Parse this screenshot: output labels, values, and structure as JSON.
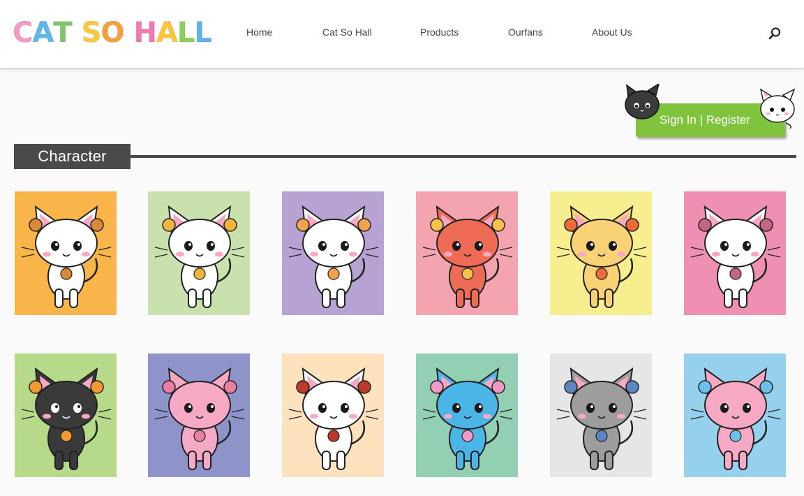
{
  "header": {
    "logo_words": [
      [
        {
          "ch": "C",
          "color": "#f29ac6"
        },
        {
          "ch": "A",
          "color": "#5bb8e8"
        },
        {
          "ch": "T",
          "color": "#7cc66c"
        }
      ],
      [
        {
          "ch": "S",
          "color": "#f7c93a"
        },
        {
          "ch": "O",
          "color": "#f6a03b"
        }
      ],
      [
        {
          "ch": "H",
          "color": "#ee7ab0"
        },
        {
          "ch": "A",
          "color": "#f8c73c"
        },
        {
          "ch": "L",
          "color": "#8ccf5a"
        },
        {
          "ch": "L",
          "color": "#5fb4e6"
        }
      ]
    ],
    "nav": [
      {
        "label": "Home"
      },
      {
        "label": "Cat So Hall"
      },
      {
        "label": "Products"
      },
      {
        "label": "Ourfans"
      },
      {
        "label": "About Us"
      }
    ]
  },
  "signin": {
    "label": "Sign In | Register",
    "color": "#7fc43c"
  },
  "section": {
    "title": "Character"
  },
  "characters": [
    {
      "sign": "aries",
      "bg": "#f9b54a",
      "fur": "#ffffff",
      "accent": "#d9893a"
    },
    {
      "sign": "taurus",
      "bg": "#c9e2ad",
      "fur": "#ffffff",
      "accent": "#f0b43c"
    },
    {
      "sign": "gemini",
      "bg": "#b6a3d3",
      "fur": "#ffffff",
      "accent": "#f2a24a"
    },
    {
      "sign": "cancer",
      "bg": "#f3a4ae",
      "fur": "#ee6b55",
      "accent": "#f4c24a"
    },
    {
      "sign": "leo",
      "bg": "#f7ef8f",
      "fur": "#f9d276",
      "accent": "#ee6a36"
    },
    {
      "sign": "virgo",
      "bg": "#ef8fb3",
      "fur": "#ffffff",
      "accent": "#c6657f"
    },
    {
      "sign": "libra",
      "bg": "#b6d98a",
      "fur": "#3a3a3a",
      "accent": "#f29a2e"
    },
    {
      "sign": "scorpio",
      "bg": "#8e94c9",
      "fur": "#f6a9c4",
      "accent": "#e97fa6"
    },
    {
      "sign": "sagittarius",
      "bg": "#fde2bd",
      "fur": "#ffffff",
      "accent": "#c03a2b"
    },
    {
      "sign": "capricorn",
      "bg": "#93cfb2",
      "fur": "#4bb6e6",
      "accent": "#f29ac6"
    },
    {
      "sign": "aquarius",
      "bg": "#e6e6e6",
      "fur": "#9d9d9d",
      "accent": "#5c86c2"
    },
    {
      "sign": "pisces",
      "bg": "#95d0ec",
      "fur": "#f6a9c4",
      "accent": "#6cc0ea"
    }
  ]
}
